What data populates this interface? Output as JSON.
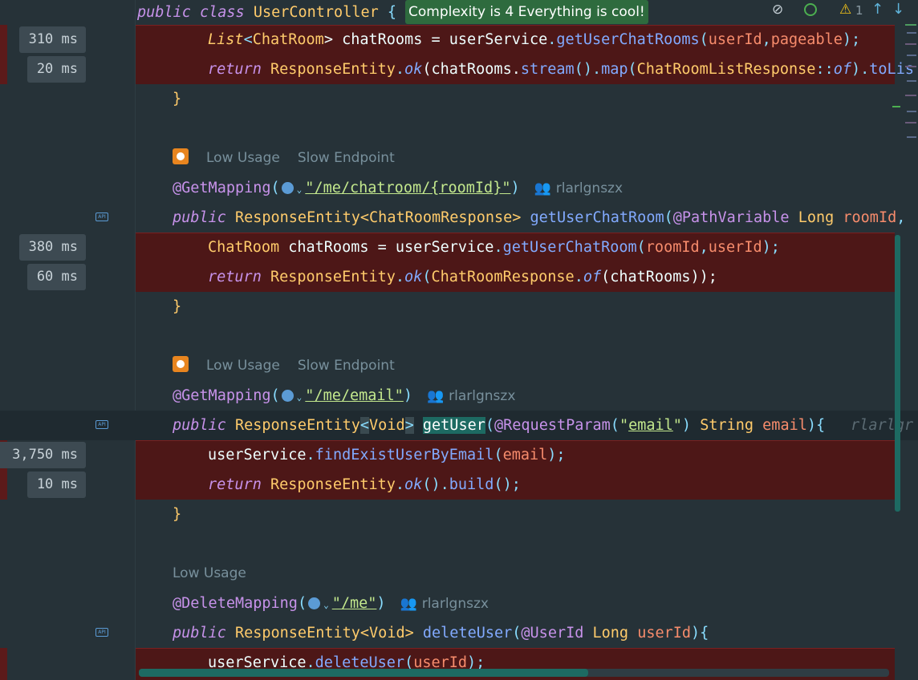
{
  "banner": {
    "text": "Complexity is 4 Everything is cool!"
  },
  "toolbar": {
    "warning_count": "1",
    "eye_icon": "eye-crossed-icon",
    "check_icon": "circle-icon",
    "up_icon": "arrow-up-icon",
    "down_icon": "arrow-down-icon"
  },
  "class_header": {
    "kw1": "public",
    "kw2": "class",
    "name": "UserController",
    "brace": "{"
  },
  "timings": {
    "t310": "310 ms",
    "t20": "20 ms",
    "t380": "380 ms",
    "t60": "60 ms",
    "t3750": "3,750 ms",
    "t10": "10 ms"
  },
  "hints": {
    "low_usage": "Low Usage",
    "slow_endpoint": "Slow Endpoint",
    "author": "rlarlgnszx",
    "author_inline": "rlarlgr"
  },
  "code": {
    "l1": {
      "t1": "List",
      "t2": "<",
      "t3": "ChatRoom",
      "t4": "> chatRooms = ",
      "t5": "userService",
      "t6": ".",
      "t7": "getUserChatRooms",
      "t8": "(",
      "t9": "userId",
      "t10": ",",
      "t11": "pageable",
      "t12": ");"
    },
    "l2": {
      "t1": "return ",
      "t2": "ResponseEntity",
      "t3": ".",
      "t4": "ok",
      "t5": "(chatRooms.",
      "t6": "stream",
      "t7": "().",
      "t8": "map",
      "t9": "(",
      "t10": "ChatRoomListResponse",
      "t11": "::",
      "t12": "of",
      "t13": ").",
      "t14": "toLis"
    },
    "close": "}",
    "m2": {
      "ann": "@GetMapping",
      "open": "(",
      "path": "\"/me/chatroom/{roomId}\"",
      "close": ")"
    },
    "s2": {
      "kw": "public",
      "ret": "ResponseEntity",
      "gen": "<ChatRoomResponse>",
      "name": "getUserChatRoom",
      "p1": "(",
      "ann": "@PathVariable",
      "ptype": "Long",
      "pname": "roomId",
      "rest": ","
    },
    "b2a": {
      "t1": "ChatRoom",
      "t2": " chatRooms = ",
      "t3": "userService",
      "t4": ".",
      "t5": "getUserChatRoom",
      "t6": "(",
      "t7": "roomId",
      "t8": ",",
      "t9": "userId",
      "t10": ");"
    },
    "b2b": {
      "t1": "return ",
      "t2": "ResponseEntity",
      "t3": ".",
      "t4": "ok",
      "t5": "(",
      "t6": "ChatRoomResponse",
      "t7": ".",
      "t8": "of",
      "t9": "(chatRooms));"
    },
    "m3": {
      "ann": "@GetMapping",
      "open": "(",
      "path": "\"/me/email\"",
      "close": ")"
    },
    "s3": {
      "kw": "public",
      "ret": "ResponseEntity",
      "lt": "<",
      "gen": "Void",
      "gt": ">",
      "name": "getUser",
      "p1": "(",
      "ann": "@RequestParam",
      "po": "(",
      "q1": "\"",
      "pval": "email",
      "q2": "\"",
      "pc": ")",
      "ptype": "String",
      "pname": "email",
      "rest": "){"
    },
    "b3a": {
      "t1": "userService",
      "t2": ".",
      "t3": "findExistUserByEmail",
      "t4": "(",
      "t5": "email",
      "t6": ");"
    },
    "b3b": {
      "t1": "return ",
      "t2": "ResponseEntity",
      "t3": ".",
      "t4": "ok",
      "t5": "().",
      "t6": "build",
      "t7": "();"
    },
    "m4": {
      "ann": "@DeleteMapping",
      "open": "(",
      "path": "\"/me\"",
      "close": ")"
    },
    "s4": {
      "kw": "public",
      "ret": "ResponseEntity",
      "gen": "<Void>",
      "name": "deleteUser",
      "p1": "(",
      "ann": "@UserId",
      "ptype": "Long",
      "pname": "userId",
      "rest": "){"
    },
    "b4a": {
      "t1": "userService",
      "t2": ".",
      "t3": "deleteUser",
      "t4": "(",
      "t5": "userId",
      "t6": ");"
    }
  },
  "colors": {
    "background": "#263238",
    "error_line": "#4d1717",
    "banner_bg": "#2e6b3e"
  }
}
